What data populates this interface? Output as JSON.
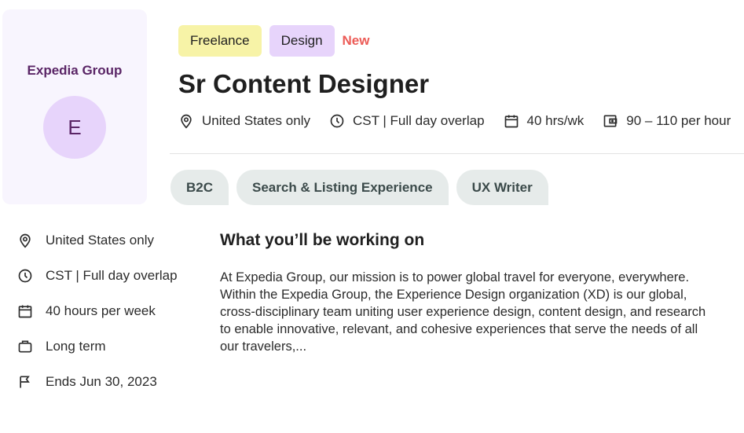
{
  "company": {
    "name": "Expedia Group",
    "avatar_letter": "E"
  },
  "tags": {
    "freelance": "Freelance",
    "design": "Design",
    "new": "New"
  },
  "job_title": "Sr Content Designer",
  "meta": {
    "location": "United States only",
    "timezone": "CST | Full day overlap",
    "hours": "40 hrs/wk",
    "rate": "90 – 110 per hour"
  },
  "skills": [
    "B2C",
    "Search & Listing Experience",
    "UX Writer"
  ],
  "details": {
    "location": "United States only",
    "timezone": "CST | Full day overlap",
    "hours": "40 hours per week",
    "duration": "Long term",
    "ends": "Ends Jun 30, 2023"
  },
  "section_title": "What you’ll be working on",
  "description": "At Expedia Group, our mission is to power global travel for everyone, everywhere. Within the Expedia Group, the Experience Design organization (XD) is our global, cross-disciplinary team uniting user experience design, content design, and research to enable innovative, relevant, and cohesive experiences that serve the needs of all our travelers,...",
  "icons": {
    "location": "map-pin-icon",
    "clock": "clock-icon",
    "calendar": "calendar-icon",
    "wallet": "wallet-icon",
    "briefcase": "briefcase-icon",
    "flag": "flag-icon"
  },
  "colors": {
    "company_card_bg": "#f8f5fe",
    "company_text": "#5a2566",
    "avatar_bg": "#e7d4fb",
    "freelance_tag": "#f7f3a7",
    "design_tag": "#e7d4fb",
    "new_badge": "#ec5b56",
    "skill_bg": "#e6ebea"
  }
}
